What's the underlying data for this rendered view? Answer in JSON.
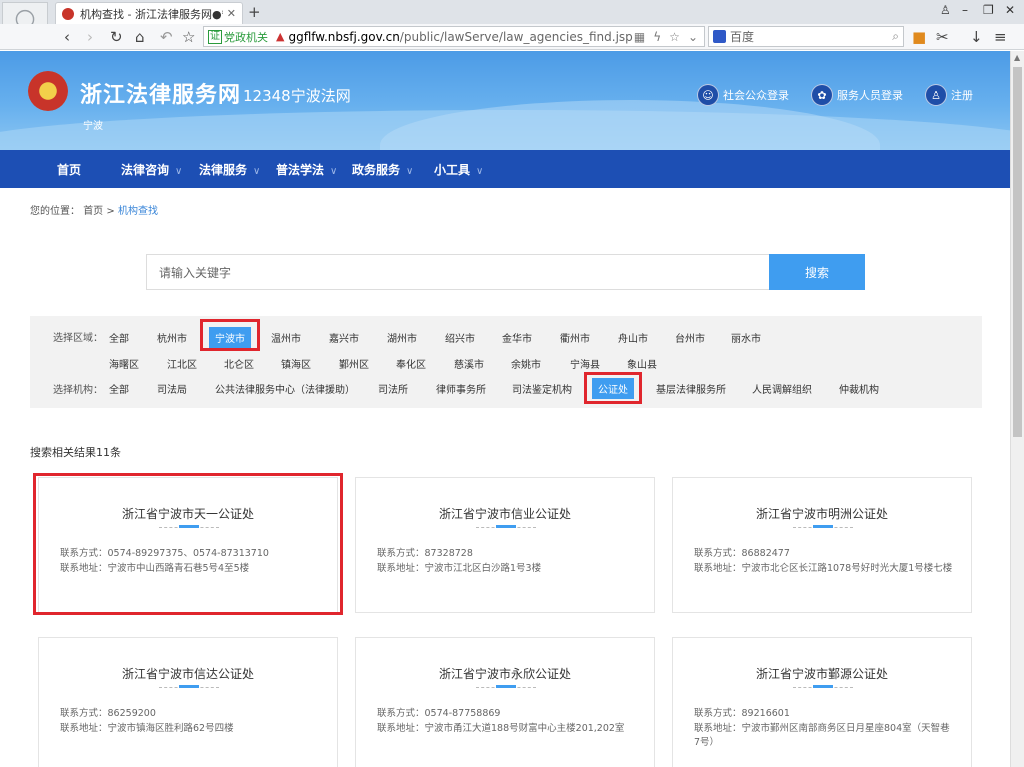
{
  "browser": {
    "tab_title": "机构查找 - 浙江法律服务网●宁波",
    "tab_close": "✕",
    "new_tab": "+",
    "url_badge": "证",
    "url_gov_label": "党政机关",
    "url_host": "ggflfw.nbsfj.gov.cn",
    "url_path": "/public/lawServe/law_agencies_find.jsp",
    "search_placeholder": "百度",
    "icons": [
      "back-icon",
      "forward-icon",
      "reload-icon",
      "home-icon",
      "undo-icon",
      "star-icon",
      "qr-icon",
      "lightning-icon",
      "extensions-icon",
      "scissors-icon",
      "download-icon",
      "menu-icon"
    ]
  },
  "header": {
    "site_title": "浙江法律服务网",
    "site_sub": "12348宁波法网",
    "city": "宁波",
    "links": [
      {
        "label": "社会公众登录",
        "icon": "public-user-icon"
      },
      {
        "label": "服务人员登录",
        "icon": "staff-icon"
      },
      {
        "label": "注册",
        "icon": "register-icon"
      }
    ]
  },
  "nav": [
    {
      "label": "首页",
      "has_menu": false
    },
    {
      "label": "法律咨询",
      "has_menu": true
    },
    {
      "label": "法律服务",
      "has_menu": true
    },
    {
      "label": "普法学法",
      "has_menu": true
    },
    {
      "label": "政务服务",
      "has_menu": true
    },
    {
      "label": "小工具",
      "has_menu": true
    }
  ],
  "breadcrumb": {
    "prefix": "您的位置：",
    "home": "首页",
    "sep": ">",
    "current": "机构查找"
  },
  "search": {
    "placeholder": "请输入关键字",
    "button": "搜索"
  },
  "filter": {
    "region_label": "选择区域：",
    "regions": [
      "全部",
      "杭州市",
      "宁波市",
      "温州市",
      "嘉兴市",
      "湖州市",
      "绍兴市",
      "金华市",
      "衢州市",
      "舟山市",
      "台州市",
      "丽水市"
    ],
    "selected_region": "宁波市",
    "districts": [
      "海曙区",
      "江北区",
      "北仑区",
      "镇海区",
      "鄞州区",
      "奉化区",
      "慈溪市",
      "余姚市",
      "宁海县",
      "象山县"
    ],
    "agency_label": "选择机构：",
    "agencies": [
      "全部",
      "司法局",
      "公共法律服务中心（法律援助）",
      "司法所",
      "律师事务所",
      "司法鉴定机构",
      "公证处",
      "基层法律服务所",
      "人民调解组织",
      "仲裁机构"
    ],
    "selected_agency": "公证处"
  },
  "results": {
    "count_text": "搜索相关结果11条",
    "contact_label": "联系方式：",
    "address_label": "联系地址：",
    "items": [
      {
        "name": "浙江省宁波市天一公证处",
        "phone": "0574-89297375、0574-87313710",
        "address": "宁波市中山西路青石巷5号4至5楼",
        "highlighted": true
      },
      {
        "name": "浙江省宁波市信业公证处",
        "phone": "87328728",
        "address": "宁波市江北区白沙路1号3楼",
        "highlighted": false
      },
      {
        "name": "浙江省宁波市明洲公证处",
        "phone": "86882477",
        "address": "宁波市北仑区长江路1078号好时光大厦1号楼七楼",
        "highlighted": false
      },
      {
        "name": "浙江省宁波市信达公证处",
        "phone": "86259200",
        "address": "宁波市镇海区胜利路62号四楼",
        "highlighted": false
      },
      {
        "name": "浙江省宁波市永欣公证处",
        "phone": "0574-87758869",
        "address": "宁波市甬江大道188号财富中心主楼201,202室",
        "highlighted": false
      },
      {
        "name": "浙江省宁波市鄞源公证处",
        "phone": "89216601",
        "address": "宁波市鄞州区南部商务区日月星座804室（天智巷",
        "address_cont": "7号）",
        "highlighted": false
      }
    ]
  },
  "accent_color": "#3f9df0",
  "nav_color": "#1d4fb4",
  "highlight_color": "#e0262d"
}
